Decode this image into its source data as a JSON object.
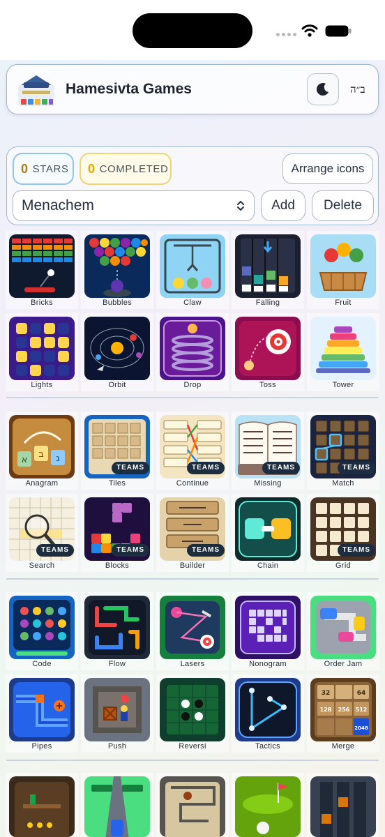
{
  "header": {
    "title": "Hamesivta Games",
    "bh_label": "ב״ה"
  },
  "stats": {
    "stars_count": "0",
    "stars_label": "STARS",
    "completed_count": "0",
    "completed_label": "COMPLETED"
  },
  "controls": {
    "arrange_label": "Arrange icons",
    "player_selected": "Menachem",
    "add_label": "Add",
    "delete_label": "Delete"
  },
  "teams_badge": "TEAMS",
  "games": [
    {
      "label": "Bricks"
    },
    {
      "label": "Bubbles"
    },
    {
      "label": "Claw"
    },
    {
      "label": "Falling"
    },
    {
      "label": "Fruit"
    },
    {
      "label": "Lights"
    },
    {
      "label": "Orbit"
    },
    {
      "label": "Drop"
    },
    {
      "label": "Toss"
    },
    {
      "label": "Tower"
    },
    {
      "label": "Anagram"
    },
    {
      "label": "Tiles"
    },
    {
      "label": "Continue"
    },
    {
      "label": "Missing"
    },
    {
      "label": "Match"
    },
    {
      "label": "Search"
    },
    {
      "label": "Blocks"
    },
    {
      "label": "Builder"
    },
    {
      "label": "Chain"
    },
    {
      "label": "Grid"
    },
    {
      "label": "Code"
    },
    {
      "label": "Flow"
    },
    {
      "label": "Lasers"
    },
    {
      "label": "Nonogram"
    },
    {
      "label": "Order Jam"
    },
    {
      "label": "Pipes"
    },
    {
      "label": "Push"
    },
    {
      "label": "Reversi"
    },
    {
      "label": "Tactics"
    },
    {
      "label": "Merge"
    }
  ],
  "icon_text": {
    "anagram": [
      "א",
      "ב",
      "ג"
    ],
    "merge": [
      "32",
      "64",
      "128",
      "256",
      "512",
      "2048"
    ]
  }
}
